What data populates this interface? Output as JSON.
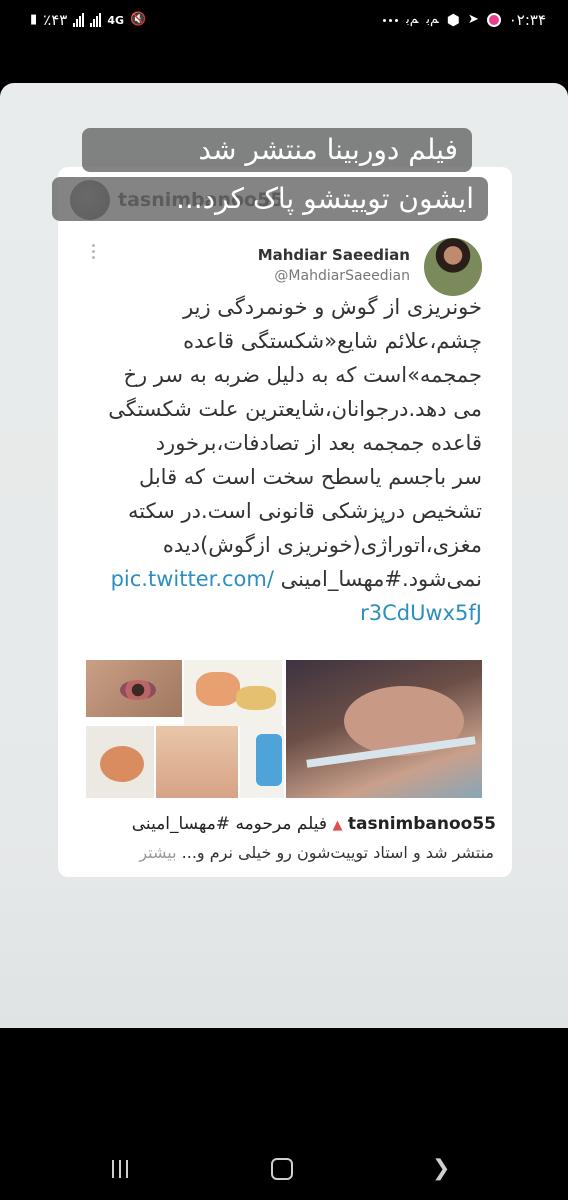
{
  "status_bar": {
    "time": "۰۲:۳۴",
    "battery": "٪۴۳",
    "network": "4G",
    "icons": [
      "mute-icon",
      "signal-icon",
      "telegram-icon",
      "hex-icon",
      "notification-icon",
      "more-dots-icon"
    ]
  },
  "story": {
    "reposter_username": "tasnimbanoo55",
    "caption_line1": "فیلم دوربینا منتشر شد",
    "caption_line2": "ایشون توییتشو پاک کرد..."
  },
  "tweet": {
    "author_name": "Mahdiar Saeedian",
    "author_handle": "@MahdiarSaeedian",
    "lines": [
      "خونریزی از گوش و خونمردگی زیر",
      "چشم،علائم شایع«شکستگی قاعده",
      "جمجمه»است که به دلیل ضربه به سر رخ",
      "می دهد.درجوانان،شایعترین علت شکستگی",
      "قاعده جمجمه بعد از تصادفات،برخورد",
      "سر باجسم یاسطح سخت است که قابل",
      "تشخیص درپزشکی قانونی است.در سکته",
      "مغزی،اتوراژی(خونریزی ازگوش)دیده"
    ],
    "last_line_text": "نمی‌شود.#مهسا_امینی",
    "link_part1": "pic.twitter.com/",
    "link_part2": "r3CdUwx5fJ"
  },
  "insta_caption": {
    "username": "tasnimbanoo55",
    "line1_text": "فیلم مرحومه #مهسا_امینی",
    "line2_text": "منتشر شد و استاد توییت‌شون رو خیلی نرم و...",
    "more_label": "بیشتر"
  },
  "colors": {
    "link": "#2b8fbf",
    "caption_bg": "#696969",
    "badge_red": "#e34d4d"
  }
}
